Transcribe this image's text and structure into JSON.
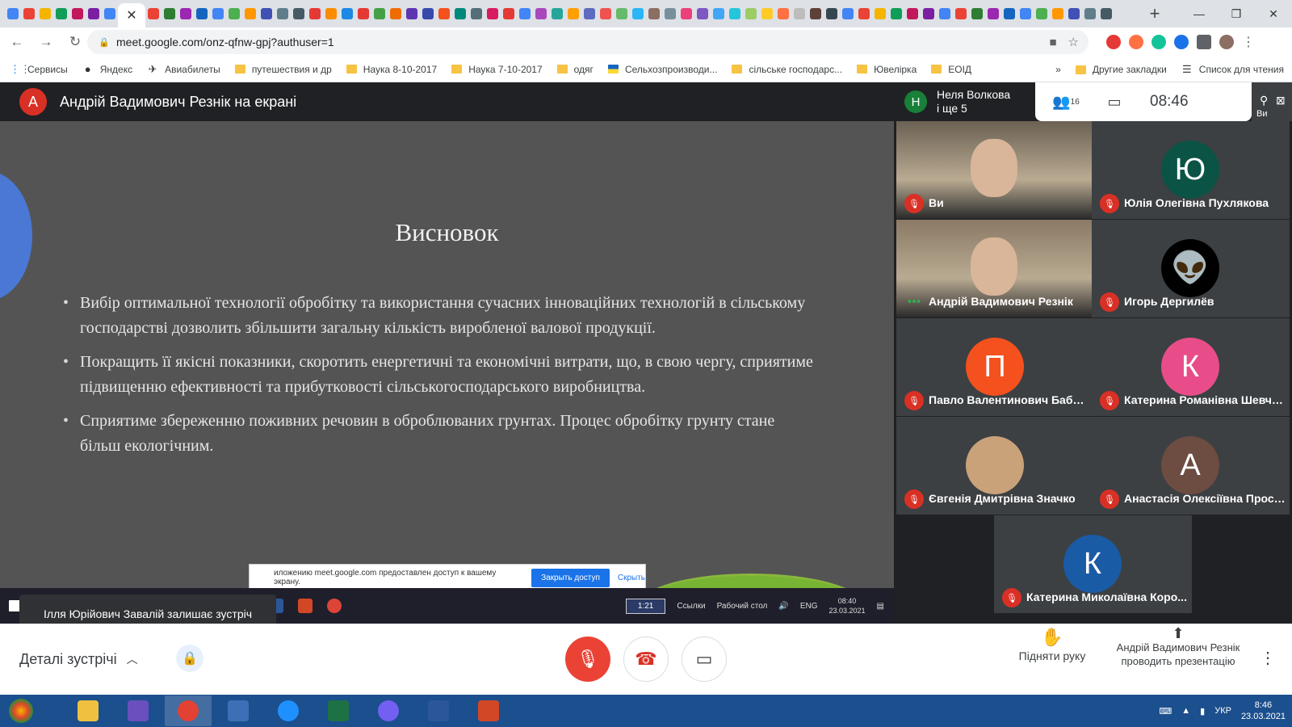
{
  "browser": {
    "url": "meet.google.com/onz-qfnw-gpj?authuser=1",
    "tab_close": "✕",
    "new_tab": "+",
    "favicon_colors": [
      "#4285f4",
      "#ea4335",
      "#f4b400",
      "#0f9d58",
      "#c2185b",
      "#7b1fa2",
      "#4285f4",
      "#ea4335",
      "#2e7d32",
      "#9c27b0",
      "#1565c0",
      "#4285f4",
      "#4caf50",
      "#ff9800",
      "#3f51b5",
      "#607d8b",
      "#455a64",
      "#e53935",
      "#fb8c00",
      "#1e88e5",
      "#e53935",
      "#43a047",
      "#ef6c00",
      "#5e35b1",
      "#3949ab",
      "#f4511e",
      "#00897b",
      "#546e7a",
      "#d81b60",
      "#e53935",
      "#4285f4",
      "#ab47bc",
      "#26a69a",
      "#ffa000",
      "#5c6bc0",
      "#ef5350",
      "#66bb6a",
      "#29b6f6",
      "#8d6e63",
      "#78909c",
      "#ec407a",
      "#7e57c2",
      "#42a5f5",
      "#26c6da",
      "#9ccc65",
      "#ffca28",
      "#ff7043",
      "#bdbdbd",
      "#5d4037",
      "#37474f",
      "#4285f4",
      "#ea4335",
      "#f4b400",
      "#0f9d58",
      "#c2185b",
      "#7b1fa2",
      "#4285f4",
      "#ea4335",
      "#2e7d32",
      "#9c27b0",
      "#1565c0",
      "#4285f4",
      "#4caf50",
      "#ff9800",
      "#3f51b5",
      "#607d8b",
      "#455a64"
    ]
  },
  "bookmarks": {
    "apps": "Сервисы",
    "items": [
      "Яндекс",
      "Авиабилеты",
      "путешествия и др",
      "Наука 8-10-2017",
      "Наука 7-10-2017",
      "одяг",
      "Сельхозпроизводи...",
      "сільське господарс...",
      "Ювелірка",
      "ЕОІД"
    ],
    "more": "»",
    "other": "Другие закладки",
    "reading_list": "Список для чтения"
  },
  "meet": {
    "presenter_initial": "А",
    "presenter_label": "Андрій Вадимович Резнік на екрані",
    "slide": {
      "title": "Висновок",
      "bullets": [
        "Вибір оптимальної технології обробітку та використання сучасних інноваційних технологій в сільському господарстві дозволить збільшити загальну кількість виробленої валової продукції.",
        "Покращить її якісні показники, скоротить енергетичні та економічні витрати, що, в свою чергу, сприятиме підвищенню ефективності та прибутковості сільськогосподарського виробництва.",
        "Сприятиме збереженню поживних речовин в оброблюваних грунтах. Процес обробітку грунту стане більш екологічним."
      ]
    },
    "share_banner": {
      "text": "иложению meet.google.com предоставлен доступ к вашему экрану.",
      "stop": "Закрыть доступ",
      "hide": "Скрыть"
    },
    "inner_taskbar": {
      "timer": "1:21",
      "links": "Ссылки",
      "desktop": "Рабочий стол",
      "lang": "ENG",
      "time": "08:40",
      "date": "23.03.2021"
    },
    "toast": "Ілля Юрійович Завалій залишає зустріч",
    "panel": {
      "header_initial": "Н",
      "header_name": "Неля Волкова",
      "header_more": "і ще 5",
      "people_count": "16",
      "time": "08:46",
      "self_label": "Ви"
    },
    "participants": [
      {
        "name": "Ви",
        "initial": "",
        "color": "#6b6153",
        "video": true
      },
      {
        "name": "Юлія Олегівна Пухлякова",
        "initial": "Ю",
        "color": "#0b5345",
        "video": false
      },
      {
        "name": "Андрій Вадимович Резнік",
        "initial": "",
        "color": "#8a7a65",
        "video": true,
        "speaking": true
      },
      {
        "name": "Игорь Дергилёв",
        "initial": "👽",
        "color": "#000000",
        "video": false
      },
      {
        "name": "Павло Валентинович Бабан...",
        "initial": "П",
        "color": "#f4511e",
        "video": false
      },
      {
        "name": "Катерина Романівна Шевче...",
        "initial": "К",
        "color": "#e84d8a",
        "video": false
      },
      {
        "name": "Євгенія Дмитрівна Значко",
        "initial": "",
        "color": "#c9a27a",
        "video": false
      },
      {
        "name": "Анастасія Олексіївна Проск...",
        "initial": "А",
        "color": "#6d4c41",
        "video": false
      },
      {
        "name": "Катерина Миколаївна Коро...",
        "initial": "К",
        "color": "#1a5ba6",
        "video": false
      }
    ],
    "bottom": {
      "details": "Деталі зустрічі",
      "raise_hand": "Підняти руку",
      "presenting": "Андрій Вадимович Резнік проводить презентацію"
    }
  },
  "taskbar": {
    "lang": "УКР",
    "time": "8:46",
    "date": "23.03.2021",
    "apps": [
      "explorer",
      "media",
      "chrome",
      "remote",
      "ie",
      "excel",
      "viber",
      "word",
      "powerpoint"
    ],
    "app_colors": [
      "#f0c040",
      "#6a4fbf",
      "#e34133",
      "#3b6fb6",
      "#1e90ff",
      "#1e7145",
      "#7360f2",
      "#2b579a",
      "#d24726"
    ]
  }
}
